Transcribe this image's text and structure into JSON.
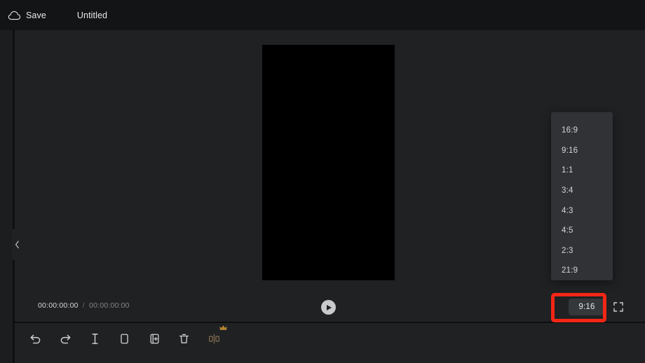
{
  "header": {
    "save_icon": "cloud-icon",
    "save_label": "Save",
    "project_title": "Untitled"
  },
  "sidebar": {
    "collapse_icon": "chevron-left-icon"
  },
  "preview": {
    "canvas_label": "video-preview-canvas",
    "canvas_color": "#000000"
  },
  "playback": {
    "current_time": "00:00:00:00",
    "separator": "/",
    "total_time": "00:00:00:00",
    "play_icon": "play-icon",
    "aspect_ratio_value": "9:16",
    "fullscreen_icon": "fullscreen-icon"
  },
  "aspect_menu": {
    "options": [
      {
        "label": "16:9"
      },
      {
        "label": "9:16"
      },
      {
        "label": "1:1"
      },
      {
        "label": "3:4"
      },
      {
        "label": "4:3"
      },
      {
        "label": "4:5"
      },
      {
        "label": "2:3"
      },
      {
        "label": "21:9"
      }
    ]
  },
  "toolbar": {
    "items": [
      {
        "name": "undo-icon",
        "label": "Undo"
      },
      {
        "name": "redo-icon",
        "label": "Redo"
      },
      {
        "name": "split-icon",
        "label": "Split"
      },
      {
        "name": "copy-icon",
        "label": "Copy"
      },
      {
        "name": "duplicate-icon",
        "label": "Duplicate"
      },
      {
        "name": "delete-icon",
        "label": "Delete"
      },
      {
        "name": "mirror-icon",
        "label": "Mirror"
      }
    ]
  },
  "annotation": {
    "highlight_color": "#f42616",
    "target": "aspect-ratio-button"
  }
}
